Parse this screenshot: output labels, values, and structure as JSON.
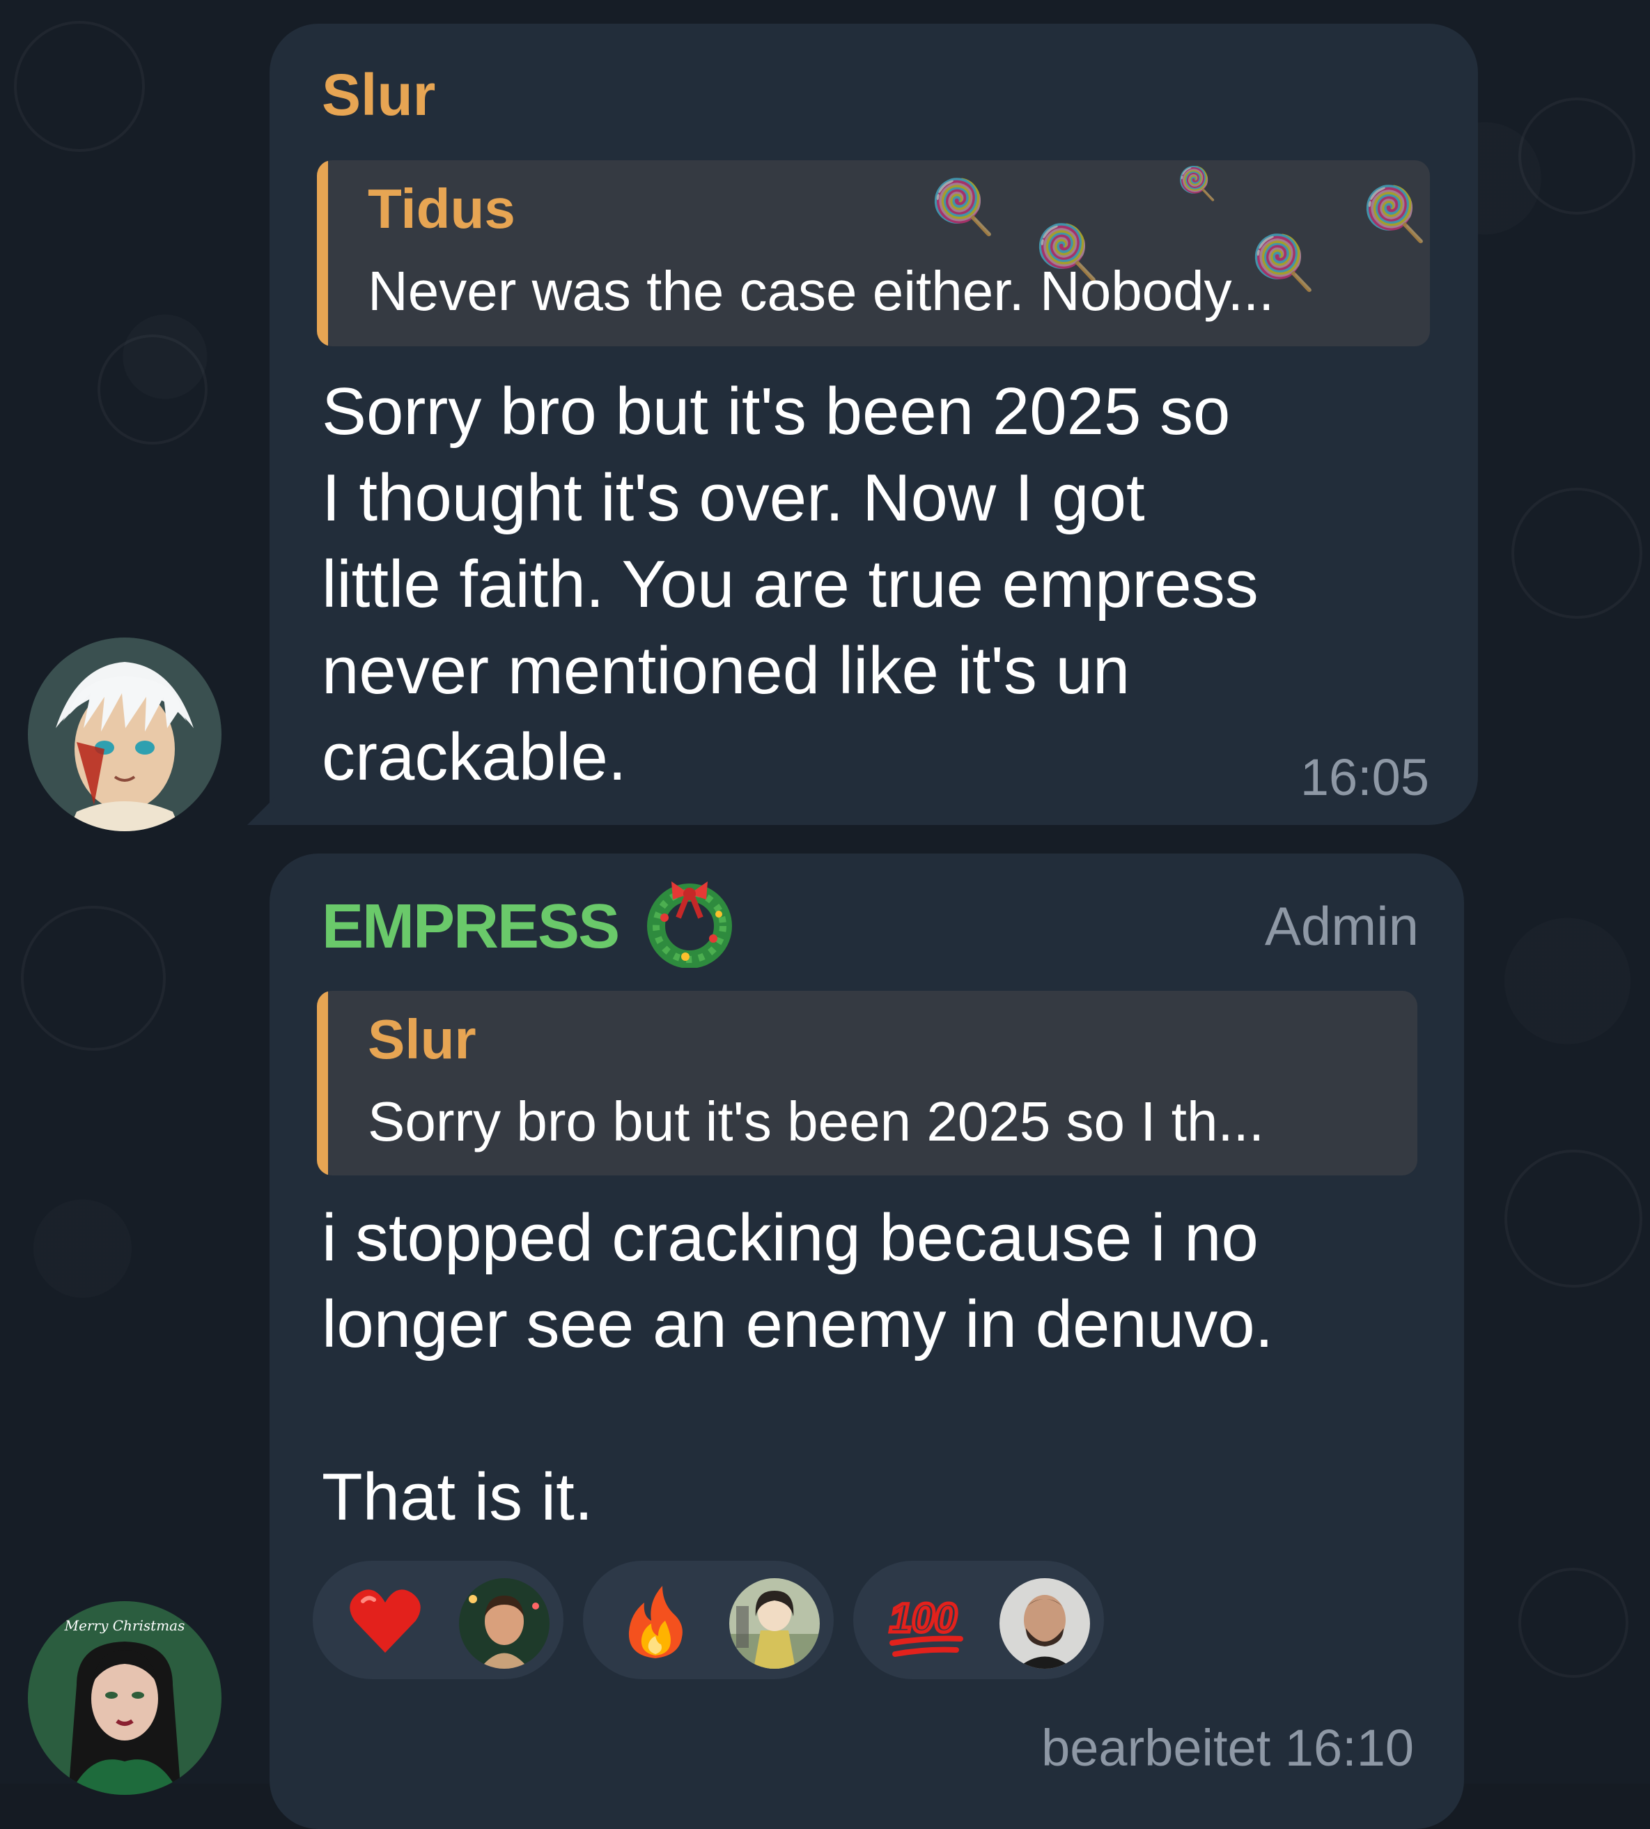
{
  "messages": [
    {
      "sender": "Slur",
      "sender_color": "#e7a553",
      "avatar_icon": "anime-character-avatar",
      "reply": {
        "name": "Tidus",
        "text": "Never was the case either. Nobody..."
      },
      "text": "Sorry bro but it's been 2025 so\nI thought it's over. Now I got\nlittle faith. You are true empress\nnever mentioned like it's un\ncrackable.",
      "time": "16:05"
    },
    {
      "sender": "EMPRESS",
      "sender_color": "#6ac96a",
      "sender_badge_icon": "christmas-wreath-icon",
      "role": "Admin",
      "avatar_icon": "woman-portrait-avatar",
      "avatar_caption": "Merry Christmas",
      "reply": {
        "name": "Slur",
        "text": "Sorry bro but it's been 2025 so I th..."
      },
      "text": "i stopped cracking because i no\nlonger see an enemy in denuvo.\n\nThat is it.",
      "time": "bearbeitet 16:10",
      "reactions": [
        {
          "emoji_icon": "heart-icon",
          "user_avatar": "man-avatar"
        },
        {
          "emoji_icon": "fire-icon",
          "user_avatar": "drawn-girl-avatar"
        },
        {
          "emoji_icon": "hundred-points-icon",
          "user_avatar": "bald-man-avatar"
        }
      ]
    }
  ],
  "theme": {
    "background": "#161d26",
    "bubble": "#222d3a",
    "quote_bg": "#353a42",
    "quote_accent": "#e7a553",
    "reaction_bg": "#2d3948",
    "meta_text": "#8e98a5"
  }
}
